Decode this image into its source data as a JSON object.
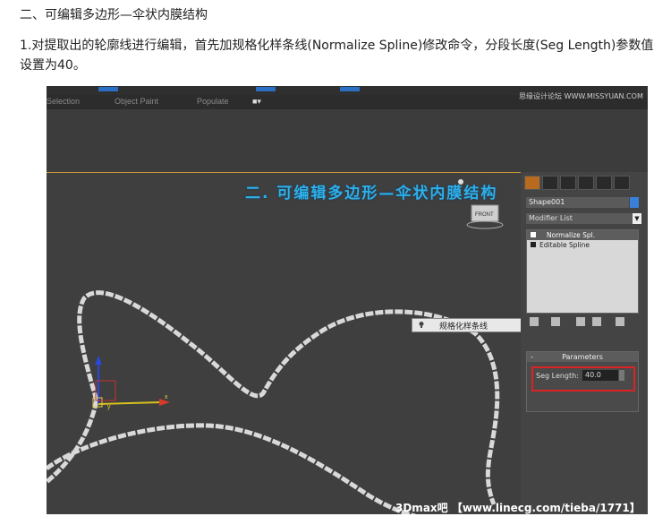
{
  "document": {
    "heading": "二、可编辑多边形—伞状内膜结构",
    "paragraph": "1.对提取出的轮廓线进行编辑，首先加规格化样条线(Normalize Spline)修改命令，分段长度(Seg Length)参数值设置为40。"
  },
  "screenshot": {
    "tabs": {
      "selection": "Selection",
      "object_paint": "Object Paint",
      "populate": "Populate"
    },
    "overlay_title": "二. 可编辑多边形—伞状内膜结构",
    "watermark_top": "思缘设计论坛 WWW.MISSYUAN.COM",
    "watermark_bottom": "3Dmax吧 【www.linecg.com/tieba/1771】",
    "context_menu_label": "规格化样条线",
    "viewcube_label": "FRONT",
    "axis": {
      "x": "x",
      "y": "y",
      "z": "z"
    },
    "panel": {
      "object_name": "Shape001",
      "modifier_list": "Modifier List",
      "dropdown_arrow": "▼",
      "stack": [
        {
          "label": "Normalize Spl.",
          "selected": true
        },
        {
          "label": "Editable Spline",
          "selected": false
        }
      ],
      "rollout_title": "Parameters",
      "rollout_collapse": "-",
      "seg_length_label": "Seg Length:",
      "seg_length_value": "40.0"
    },
    "colors": {
      "accent_blue": "#2fb0e8",
      "highlight_red": "#dd2222",
      "viewport_bg": "#3f3f3f"
    }
  }
}
